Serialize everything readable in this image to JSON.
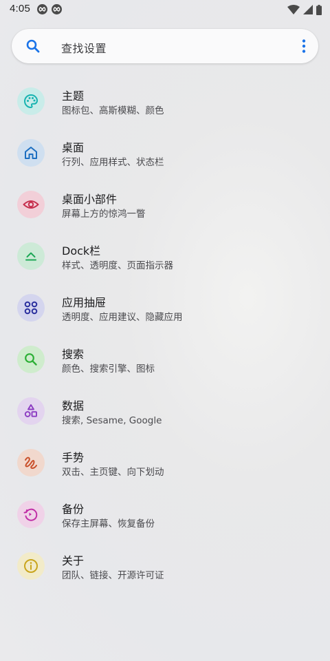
{
  "status_bar": {
    "time": "4:05"
  },
  "search": {
    "placeholder": "查找设置"
  },
  "items": [
    {
      "title": "主题",
      "subtitle": "图标包、高斯模糊、颜色",
      "icon": "palette-icon",
      "bg": "#c9ece9",
      "fg": "#17b3b0"
    },
    {
      "title": "桌面",
      "subtitle": "行列、应用样式、状态栏",
      "icon": "home-icon",
      "bg": "#cfdff0",
      "fg": "#1d6fc1"
    },
    {
      "title": "桌面小部件",
      "subtitle": "屏幕上方的惊鸿一瞥",
      "icon": "eye-icon",
      "bg": "#f2cfd8",
      "fg": "#c62f4d"
    },
    {
      "title": "Dock栏",
      "subtitle": "样式、透明度、页面指示器",
      "icon": "dock-icon",
      "bg": "#cdead7",
      "fg": "#1ea857"
    },
    {
      "title": "应用抽屉",
      "subtitle": "透明度、应用建议、隐藏应用",
      "icon": "apps-grid-icon",
      "bg": "#d4d5ee",
      "fg": "#2a2f9e"
    },
    {
      "title": "搜索",
      "subtitle": "颜色、搜索引擎、图标",
      "icon": "search-icon",
      "bg": "#cfeccd",
      "fg": "#2caf35"
    },
    {
      "title": "数据",
      "subtitle": "搜索, Sesame, Google",
      "icon": "shapes-icon",
      "bg": "#e3d4ef",
      "fg": "#8c3cc2"
    },
    {
      "title": "手势",
      "subtitle": "双击、主页键、向下划动",
      "icon": "gesture-icon",
      "bg": "#f1d8cd",
      "fg": "#c9502b"
    },
    {
      "title": "备份",
      "subtitle": "保存主屏幕、恢复备份",
      "icon": "backup-icon",
      "bg": "#f0d2e8",
      "fg": "#c02ea6"
    },
    {
      "title": "关于",
      "subtitle": "团队、链接、开源许可证",
      "icon": "info-icon",
      "bg": "#f2ebc9",
      "fg": "#c9a51d"
    }
  ],
  "colors": {
    "accent": "#1a73e8"
  }
}
